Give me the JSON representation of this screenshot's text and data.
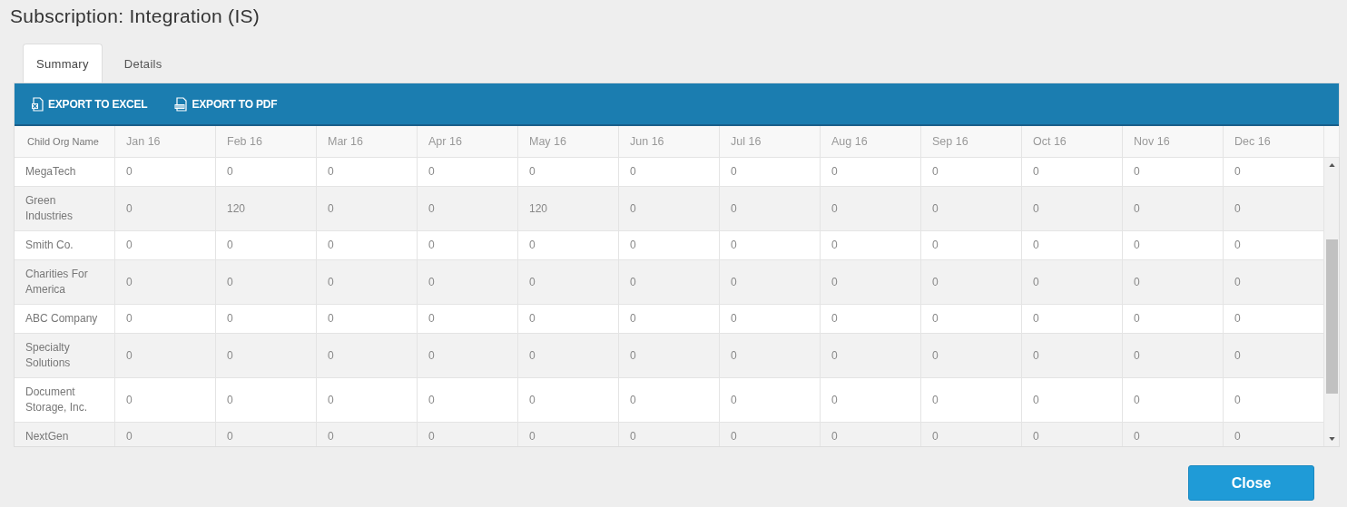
{
  "title": "Subscription: Integration (IS)",
  "tabs": [
    {
      "label": "Summary",
      "selected": true
    },
    {
      "label": "Details",
      "selected": false
    }
  ],
  "toolbar": [
    {
      "label": "EXPORT TO EXCEL",
      "kind": "excel"
    },
    {
      "label": "EXPORT TO PDF",
      "kind": "pdf"
    }
  ],
  "table": {
    "columns": [
      "Child Org Name",
      "Jan 16",
      "Feb 16",
      "Mar 16",
      "Apr 16",
      "May 16",
      "Jun 16",
      "Jul 16",
      "Aug 16",
      "Sep 16",
      "Oct 16",
      "Nov 16",
      "Dec 16"
    ],
    "rows": [
      {
        "name": "MegaTech",
        "values": [
          "0",
          "0",
          "0",
          "0",
          "0",
          "0",
          "0",
          "0",
          "0",
          "0",
          "0",
          "0"
        ]
      },
      {
        "name": "Green Industries",
        "values": [
          "0",
          "120",
          "0",
          "0",
          "120",
          "0",
          "0",
          "0",
          "0",
          "0",
          "0",
          "0"
        ]
      },
      {
        "name": "Smith Co.",
        "values": [
          "0",
          "0",
          "0",
          "0",
          "0",
          "0",
          "0",
          "0",
          "0",
          "0",
          "0",
          "0"
        ]
      },
      {
        "name": "Charities For America",
        "values": [
          "0",
          "0",
          "0",
          "0",
          "0",
          "0",
          "0",
          "0",
          "0",
          "0",
          "0",
          "0"
        ]
      },
      {
        "name": "ABC Company",
        "values": [
          "0",
          "0",
          "0",
          "0",
          "0",
          "0",
          "0",
          "0",
          "0",
          "0",
          "0",
          "0"
        ]
      },
      {
        "name": "Specialty Solutions",
        "values": [
          "0",
          "0",
          "0",
          "0",
          "0",
          "0",
          "0",
          "0",
          "0",
          "0",
          "0",
          "0"
        ]
      },
      {
        "name": "Document Storage, Inc.",
        "values": [
          "0",
          "0",
          "0",
          "0",
          "0",
          "0",
          "0",
          "0",
          "0",
          "0",
          "0",
          "0"
        ]
      },
      {
        "name": "NextGen",
        "values": [
          "0",
          "0",
          "0",
          "0",
          "0",
          "0",
          "0",
          "0",
          "0",
          "0",
          "0",
          "0"
        ]
      }
    ]
  },
  "buttons": [
    "Close"
  ]
}
